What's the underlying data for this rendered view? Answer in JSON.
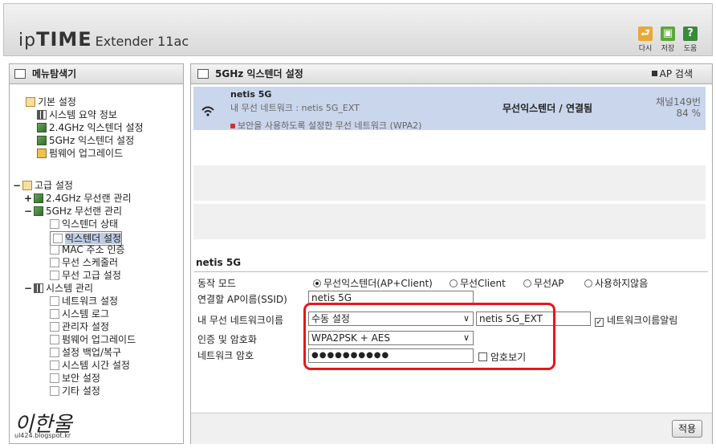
{
  "header": {
    "logo_ip": "ip",
    "logo_time": "TIME",
    "logo_model": "Extender 11ac",
    "buttons": [
      {
        "label": "다시",
        "icon": "return-icon",
        "color": "#e8a838"
      },
      {
        "label": "저장",
        "icon": "save-icon",
        "color": "#5aa83a"
      },
      {
        "label": "도움",
        "icon": "help-icon",
        "color": "#3a8a3a"
      }
    ]
  },
  "sidebar": {
    "title": "메뉴탐색기",
    "basic": {
      "label": "기본 설정",
      "items": [
        "시스템 요약 정보",
        "2.4GHz 익스텐더 설정",
        "5GHz 익스텐더 설정",
        "펌웨어 업그레이드"
      ]
    },
    "advanced": {
      "toggle": "−",
      "label": "고급 설정",
      "wl24": {
        "toggle": "+",
        "label": "2.4GHz 무선랜 관리"
      },
      "wl5": {
        "toggle": "−",
        "label": "5GHz 무선랜 관리",
        "items": [
          "익스텐더 상태",
          "익스텐더 설정",
          "MAC 주소 인증",
          "무선 스케줄러",
          "무선 고급 설정"
        ]
      },
      "system": {
        "toggle": "−",
        "label": "시스템 관리",
        "items": [
          "네트워크 설정",
          "시스템 로그",
          "관리자 설정",
          "펌웨어 업그레이드",
          "설정 백업/복구",
          "시스템 시간 설정",
          "보안 설정",
          "기타 설정"
        ]
      }
    },
    "signature": "이한울",
    "signature_url": "ul424.blogspot.kr"
  },
  "main": {
    "title": "5GHz 익스텐더 설정",
    "ap_search": "AP 검색",
    "ap": {
      "name": "netis 5G",
      "sub": "내 무선 네트워크 : netis 5G_EXT",
      "security": "보안을 사용하도록 설정한 무선 네트워크 (WPA2)",
      "status": "무선익스텐더 / 연결됨",
      "channel": "채널149번",
      "signal": "84 %"
    },
    "form": {
      "title": "netis 5G",
      "mode_label": "동작 모드",
      "modes": [
        {
          "label": "무선익스텐더(AP+Client)",
          "selected": true
        },
        {
          "label": "무선Client",
          "selected": false
        },
        {
          "label": "무선AP",
          "selected": false
        },
        {
          "label": "사용하지않음",
          "selected": false
        }
      ],
      "ssid_label": "연결할 AP이름(SSID)",
      "ssid_value": "netis 5G",
      "mynet_label": "내 무선 네트워크이름",
      "mynet_select": "수동 설정",
      "mynet_value": "netis 5G_EXT",
      "notify_label": "네트워크이름알림",
      "notify_checked": true,
      "auth_label": "인증 및 암호화",
      "auth_select": "WPA2PSK + AES",
      "pw_label": "네트워크 암호",
      "pw_value": "●●●●●●●●●●",
      "showpw_label": "암호보기",
      "showpw_checked": false
    },
    "apply": "적용"
  }
}
